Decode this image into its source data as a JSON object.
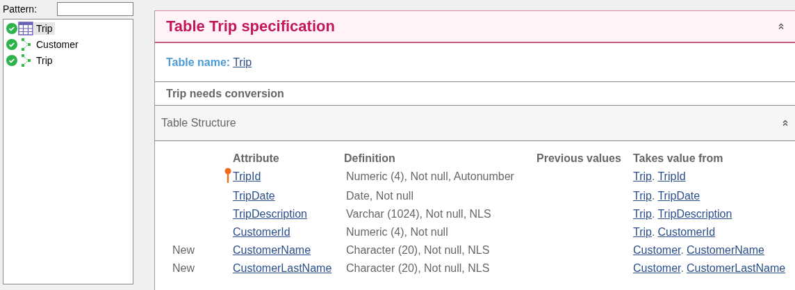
{
  "filter": {
    "label": "Pattern:"
  },
  "tree": [
    {
      "kind": "table",
      "label": "Trip",
      "ok": true,
      "selected": true
    },
    {
      "kind": "transaction",
      "label": "Customer",
      "ok": true,
      "selected": false
    },
    {
      "kind": "transaction",
      "label": "Trip",
      "ok": true,
      "selected": false
    }
  ],
  "spec": {
    "title": "Table Trip specification",
    "table_name_label": "Table name:",
    "table_name": "Trip",
    "conversion_note": "Trip needs conversion",
    "section_title": "Table Structure",
    "columns": [
      "Attribute",
      "Definition",
      "Previous values",
      "Takes value from"
    ],
    "rows": [
      {
        "key": true,
        "attribute": "TripId",
        "definition": "Numeric (4), Not null, Autonumber",
        "source_table": "Trip",
        "separator": ".",
        "source_attribute": "TripId"
      },
      {
        "key": false,
        "attribute": "TripDate",
        "definition": "Date, Not null",
        "source_table": "Trip",
        "separator": ".",
        "source_attribute": "TripDate"
      },
      {
        "key": false,
        "attribute": "TripDescription",
        "definition": "Varchar (1024), Not null, NLS",
        "source_table": "Trip",
        "separator": ".",
        "source_attribute": "TripDescription"
      },
      {
        "key": false,
        "attribute": "CustomerId",
        "definition": "Numeric (4), Not null",
        "source_table": "Trip",
        "separator": ".",
        "source_attribute": "CustomerId"
      },
      {
        "status": "New",
        "key": false,
        "attribute": "CustomerName",
        "definition": "Character (20), Not null, NLS",
        "source_table": "Customer",
        "separator": ".",
        "source_attribute": "CustomerName"
      },
      {
        "status": "New",
        "key": false,
        "attribute": "CustomerLastName",
        "definition": "Character (20), Not null, NLS",
        "source_table": "Customer",
        "separator": ".",
        "source_attribute": "CustomerLastName"
      }
    ]
  }
}
